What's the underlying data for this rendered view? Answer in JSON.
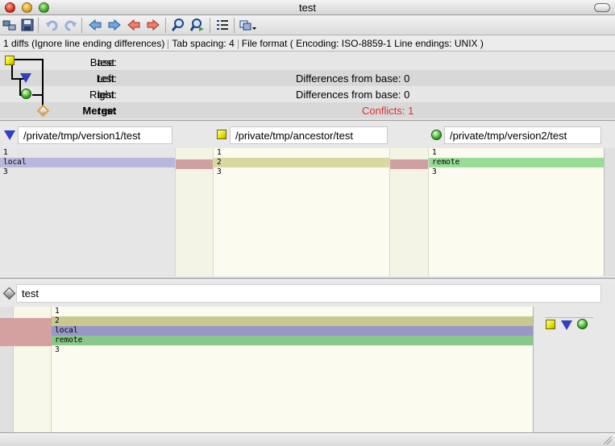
{
  "window": {
    "title": "test"
  },
  "toolbar": {
    "buttons": [
      {
        "name": "swap-icon"
      },
      {
        "name": "save-icon"
      },
      {
        "name": "undo-icon"
      },
      {
        "name": "redo-icon"
      },
      {
        "name": "prev-diff-icon"
      },
      {
        "name": "next-diff-icon"
      },
      {
        "name": "prev-conflict-icon"
      },
      {
        "name": "next-conflict-icon"
      },
      {
        "name": "find-icon"
      },
      {
        "name": "find-next-icon"
      },
      {
        "name": "list-icon"
      },
      {
        "name": "merge-menu-icon"
      }
    ]
  },
  "status": {
    "diffs": "1 diffs (Ignore line ending differences)",
    "tab_spacing": "Tab spacing: 4",
    "file_format": "File format ( Encoding: ISO-8859-1  Line endings: UNIX )"
  },
  "info": {
    "base_label": "Base:",
    "base_value": "test",
    "left_label": "Left:",
    "left_value": "test",
    "left_diffs": "Differences from base: 0",
    "right_label": "Right:",
    "right_value": "test",
    "right_diffs": "Differences from base: 0",
    "merge_label": "Merge:",
    "merge_value": "test",
    "conflicts": "Conflicts: 1"
  },
  "panes": {
    "left": {
      "path": "/private/tmp/version1/test",
      "lines": [
        "1",
        "local",
        "3"
      ]
    },
    "base": {
      "path": "/private/tmp/ancestor/test",
      "lines": [
        "1",
        "2",
        "3"
      ]
    },
    "right": {
      "path": "/private/tmp/version2/test",
      "lines": [
        "1",
        "remote",
        "3"
      ]
    }
  },
  "merge": {
    "path": "test",
    "lines": [
      "1",
      "2",
      "local",
      "remote",
      "3"
    ]
  },
  "colors": {
    "conflict_text": "#e03030",
    "left_highlight": "#b8b8dc",
    "base_highlight": "#d8d8a0",
    "right_highlight": "#98dc98",
    "conflict_gutter": "#d0a0a0"
  }
}
